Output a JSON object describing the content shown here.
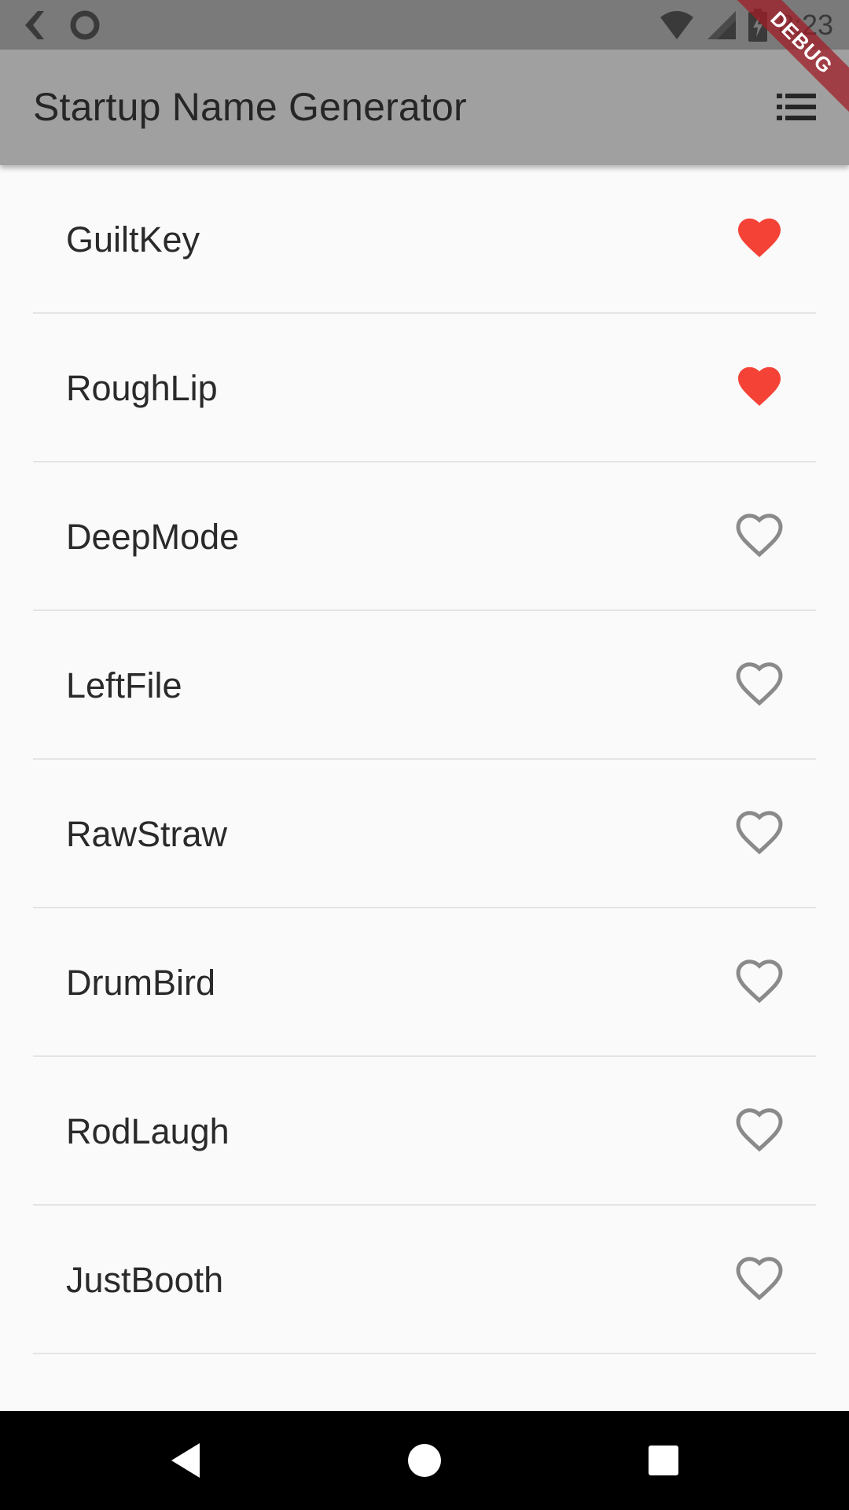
{
  "status_bar": {
    "time": "8:23",
    "icons": [
      "back-chevron-icon",
      "circle-icon",
      "wifi-icon",
      "cell-signal-icon",
      "battery-charging-icon"
    ]
  },
  "app_bar": {
    "title": "Startup Name Generator",
    "action_icon": "list-icon"
  },
  "debug_banner": "DEBUG",
  "colors": {
    "favorite": "#f44336",
    "unfavorite": "#8a8a8a",
    "app_bar": "#a0a0a0",
    "status_bar": "#7a7a7a",
    "background": "#fafafa"
  },
  "items": [
    {
      "name": "GuiltKey",
      "favorite": true
    },
    {
      "name": "RoughLip",
      "favorite": true
    },
    {
      "name": "DeepMode",
      "favorite": false
    },
    {
      "name": "LeftFile",
      "favorite": false
    },
    {
      "name": "RawStraw",
      "favorite": false
    },
    {
      "name": "DrumBird",
      "favorite": false
    },
    {
      "name": "RodLaugh",
      "favorite": false
    },
    {
      "name": "JustBooth",
      "favorite": false
    }
  ],
  "nav_bar": {
    "icons": [
      "back-triangle-icon",
      "home-circle-icon",
      "recents-square-icon"
    ]
  }
}
